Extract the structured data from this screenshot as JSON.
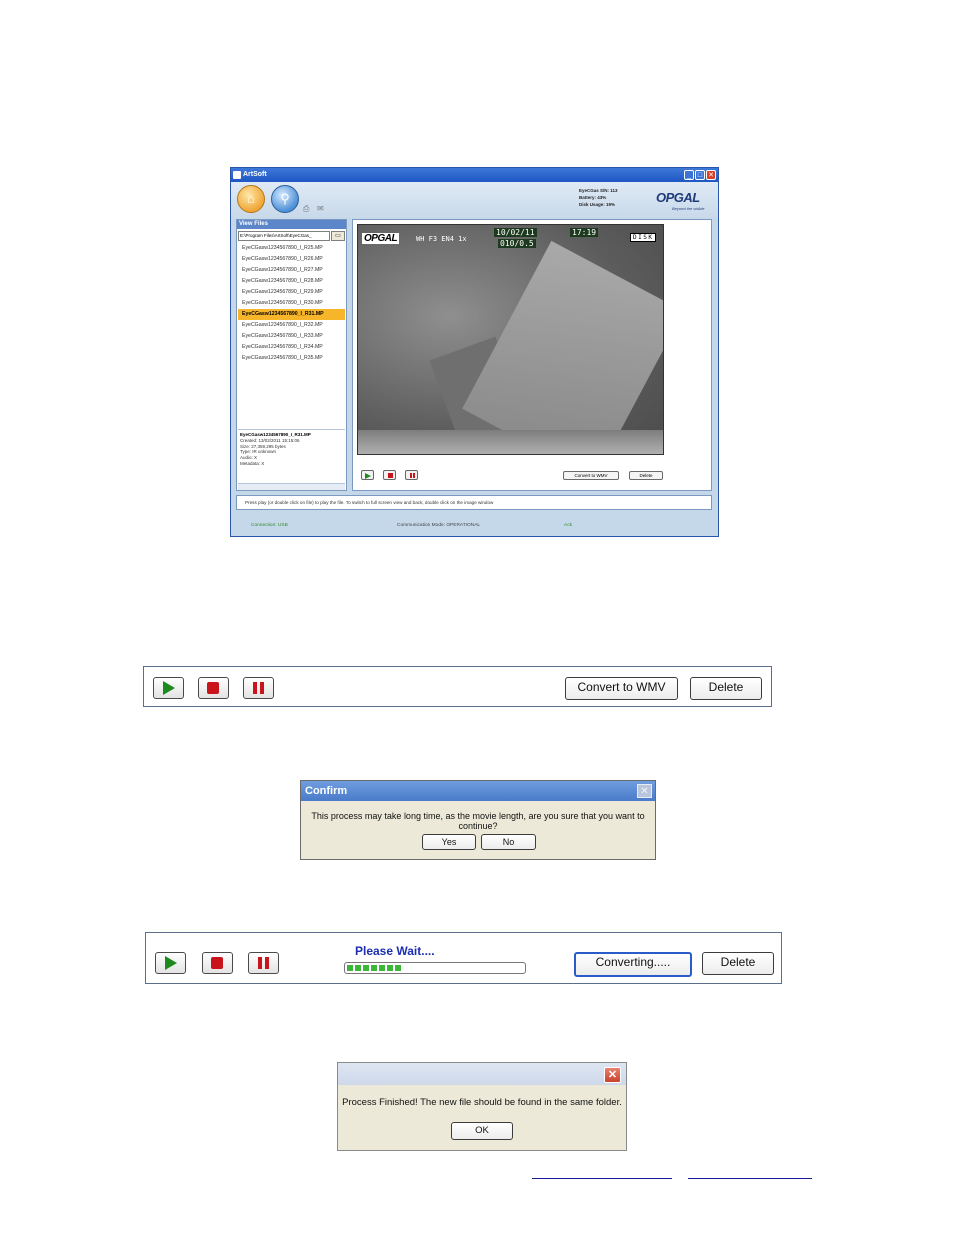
{
  "app": {
    "title": "ArtSoft",
    "window_buttons": {
      "min": "_",
      "max": "□",
      "close": "✕"
    },
    "device_info": {
      "lines": [
        "EyeCGas S/N: 113",
        "Battery:     43%",
        "Disk Usage:    19%"
      ]
    },
    "brand": {
      "logo": "OPGAL",
      "tagline": "Beyond the visible"
    },
    "view_files": {
      "header": "View Files",
      "path": "E:\\Program Files\\ArtSoft\\EyeCGas_",
      "browse_icon": "folder-icon",
      "files": [
        "EyeCGasw1234567890_I_R25.MP",
        "EyeCGasw1234567890_I_R26.MP",
        "EyeCGasw1234567890_I_R27.MP",
        "EyeCGasw1234567890_I_R28.MP",
        "EyeCGasw1234567890_I_R29.MP",
        "EyeCGasw1234567890_I_R30.MP",
        "EyeCGasw1234567890_I_R31.MP",
        "EyeCGasw1234567890_I_R32.MP",
        "EyeCGasw1234567890_I_R33.MP",
        "EyeCGasw1234567890_I_R34.MP",
        "EyeCGasw1234567890_I_R35.MP"
      ],
      "selected_index": 6,
      "info": {
        "name": "EyeCGasw1234567890_I_R31.MP",
        "created": "Created: 13/02/2011 15:15:06",
        "size": "Size: 27,359,295 bytes",
        "type": "Type: IR unknown",
        "audio": "Audio: X",
        "metadata": "Metadata: X"
      }
    },
    "video_osd": {
      "logo": "OPGAL",
      "mode": "WH  F3  EN4 1x",
      "date": "10/02/11",
      "range": "010/0.5",
      "time": "17:19",
      "storage": "DISK"
    },
    "mini_controls": {
      "convert": "Convert to WMV",
      "delete": "Delete"
    },
    "hint": "Press play (or double click on file) to play the file. To switch to full screen view and back, double click on the image window",
    "status": {
      "connection": "Connection: USB",
      "mode": "Communication Mode: OPERATIONAL",
      "ack": "Ack"
    }
  },
  "toolbar_idle": {
    "convert_label": "Convert to WMV",
    "delete_label": "Delete"
  },
  "confirm_dialog": {
    "title": "Confirm",
    "message": "This process may take long time, as the movie length, are you sure that you want to continue?",
    "yes_label": "Yes",
    "no_label": "No"
  },
  "toolbar_converting": {
    "status_text": "Please Wait....",
    "progress_fraction": 0.31,
    "convert_label": "Converting.....",
    "delete_label": "Delete"
  },
  "finished_dialog": {
    "message": "Process Finished! The new file should be found in the same folder.",
    "ok_label": "OK"
  },
  "colors": {
    "accent_blue": "#2b5bc9",
    "play_green": "#1e8a1e",
    "stop_red": "#c9141b",
    "selection": "#f7b62a"
  }
}
